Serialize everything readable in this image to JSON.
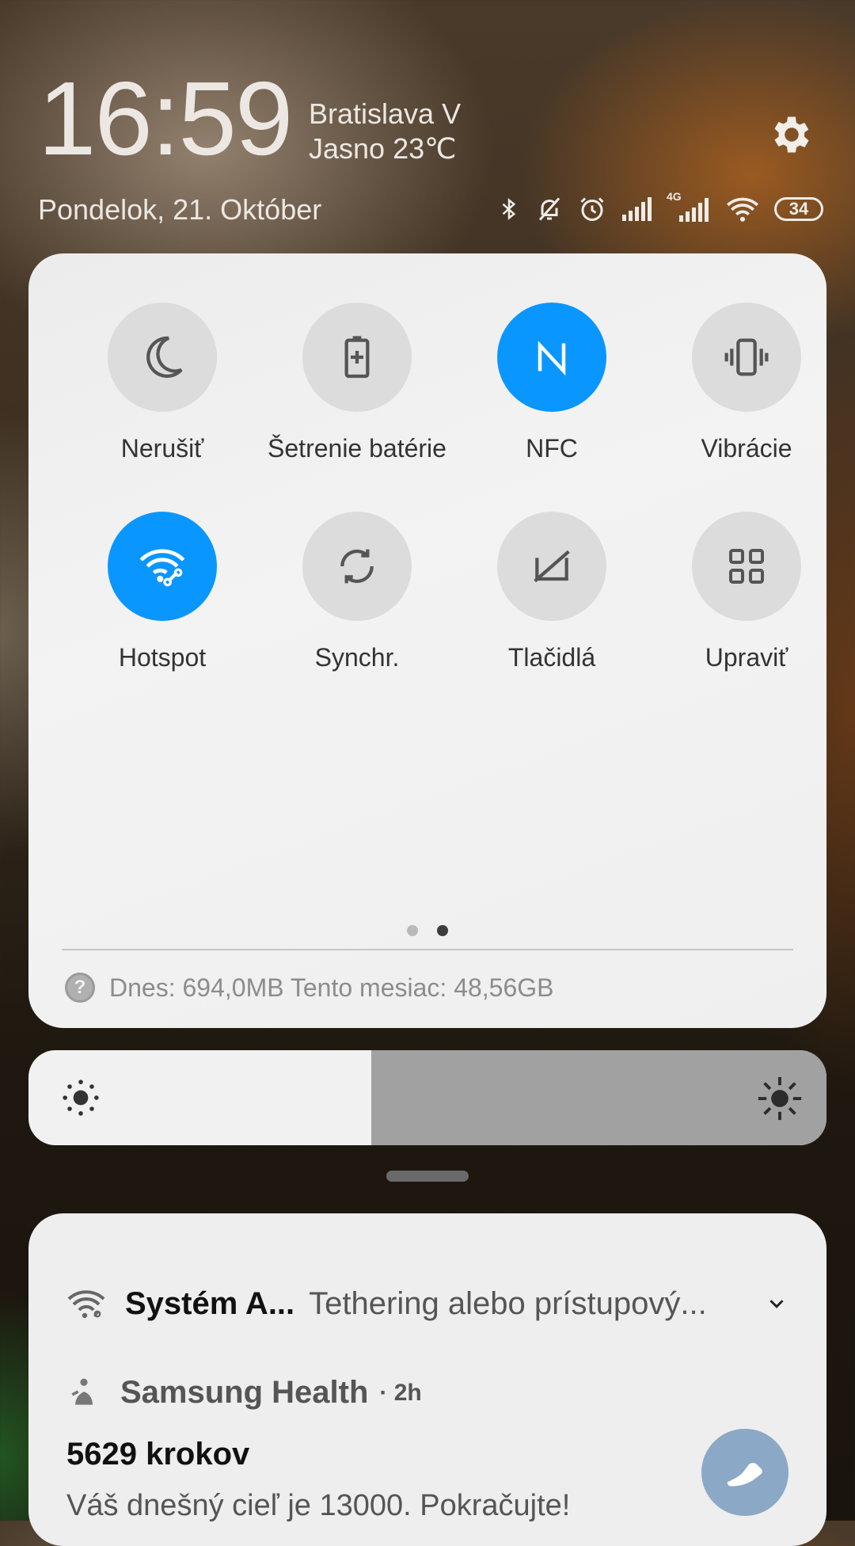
{
  "header": {
    "time": "16:59",
    "location": "Bratislava V",
    "weather": "Jasno 23℃",
    "date": "Pondelok, 21. Október",
    "network_type": "4G",
    "battery": "34"
  },
  "quick_settings": {
    "tiles": [
      {
        "label": "Nerušiť",
        "icon": "moon-icon",
        "active": false
      },
      {
        "label": "Šetrenie batérie",
        "icon": "battery-saver-icon",
        "active": false
      },
      {
        "label": "NFC",
        "icon": "nfc-icon",
        "active": true
      },
      {
        "label": "Vibrácie",
        "icon": "vibrate-icon",
        "active": false
      },
      {
        "label": "Hotspot",
        "icon": "hotspot-icon",
        "active": true
      },
      {
        "label": "Synchr.",
        "icon": "sync-icon",
        "active": false
      },
      {
        "label": "Tlačidlá",
        "icon": "buttons-icon",
        "active": false
      },
      {
        "label": "Upraviť",
        "icon": "edit-grid-icon",
        "active": false
      }
    ],
    "page_count": 2,
    "active_page": 2,
    "data_usage": "Dnes: 694,0MB Tento mesiac: 48,56GB"
  },
  "brightness": {
    "level": 0.43
  },
  "notifications": [
    {
      "app": "Systém A...",
      "message": "Tethering alebo prístupový...",
      "icon": "hotspot-icon"
    },
    {
      "app": "Samsung Health",
      "time": "2h",
      "title": "5629 krokov",
      "body": "Váš dnešný cieľ je 13000. Pokračujte!",
      "icon": "health-icon",
      "action_icon": "shoe-icon"
    }
  ],
  "colors": {
    "accent": "#0a96ff",
    "tile_off": "#dcdcdc",
    "panel": "#eeeeee"
  }
}
